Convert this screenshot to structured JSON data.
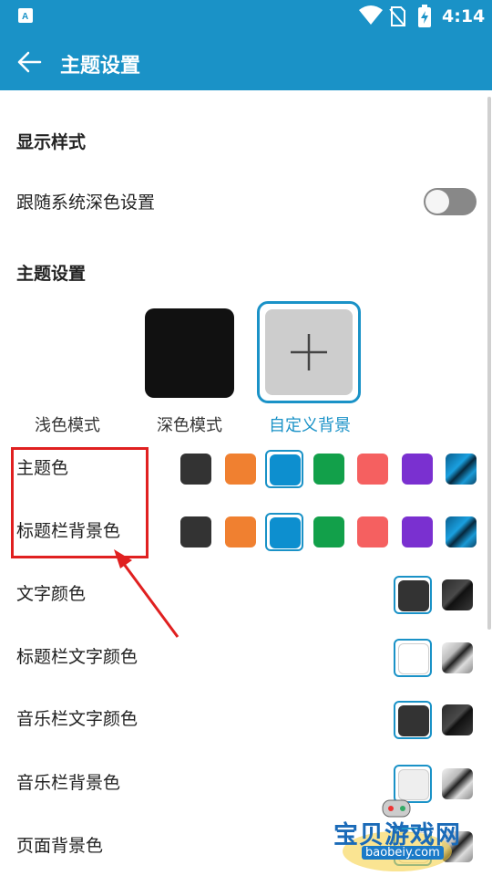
{
  "status_bar": {
    "time": "4:14",
    "icons": [
      "app-notification-icon",
      "wifi-icon",
      "no-sim-icon",
      "battery-charging-icon"
    ]
  },
  "app_bar": {
    "title": "主题设置",
    "back_icon": "arrow-left-icon"
  },
  "display_section": {
    "title": "显示样式",
    "follow_system_dark": {
      "label": "跟随系统深色设置",
      "enabled": false
    }
  },
  "theme_section": {
    "title": "主题设置",
    "modes": [
      {
        "label": "浅色模式",
        "selected": false
      },
      {
        "label": "深色模式",
        "selected": false
      },
      {
        "label": "自定义背景",
        "selected": true
      }
    ]
  },
  "color_rows": [
    {
      "label": "主题色",
      "swatches": [
        "#333333",
        "#f08030",
        "#0d8fcf",
        "#12a04a",
        "#f56060",
        "#7a30d0",
        "gradient-blue"
      ],
      "selected_index": 2
    },
    {
      "label": "标题栏背景色",
      "swatches": [
        "#333333",
        "#f08030",
        "#0d8fcf",
        "#12a04a",
        "#f56060",
        "#7a30d0",
        "gradient-blue"
      ],
      "selected_index": 2
    },
    {
      "label": "文字颜色",
      "swatches": [
        "#333333",
        "gradient-dark"
      ],
      "selected_index": 0
    },
    {
      "label": "标题栏文字颜色",
      "swatches": [
        "#ffffff",
        "gradient-silver"
      ],
      "selected_index": 0
    },
    {
      "label": "音乐栏文字颜色",
      "swatches": [
        "#333333",
        "gradient-dark"
      ],
      "selected_index": 0
    },
    {
      "label": "音乐栏背景色",
      "swatches": [
        "#eeeeee",
        "gradient-silver"
      ],
      "selected_index": 0
    },
    {
      "label": "页面背景色",
      "swatches": [
        "#ffffff",
        "gradient-silver"
      ],
      "selected_index": 0
    }
  ],
  "watermark": {
    "text": "宝贝游戏网",
    "url_text": "baobeiy.com"
  },
  "colors": {
    "accent": "#1a92c7",
    "annotation": "#e02020"
  }
}
